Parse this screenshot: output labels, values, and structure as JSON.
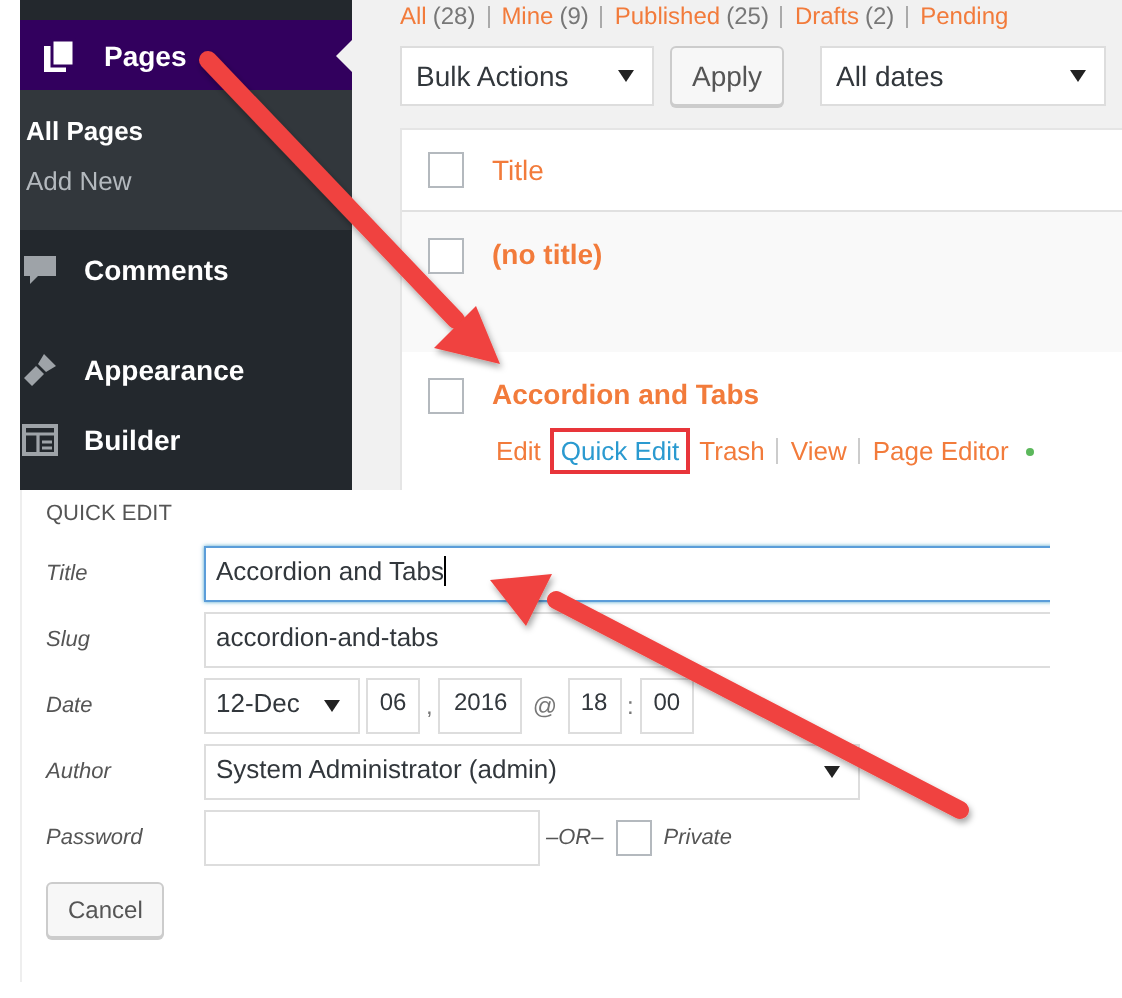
{
  "sidebar": {
    "menu": {
      "label": "Pages",
      "selected": true
    },
    "submenu": [
      {
        "label": "All Pages",
        "selected": true
      },
      {
        "label": "Add New",
        "selected": false
      }
    ],
    "items": [
      {
        "label": "Comments",
        "kind": "comments"
      },
      {
        "label": "Appearance",
        "kind": "appearance"
      },
      {
        "label": "Builder",
        "kind": "builder"
      }
    ]
  },
  "filters": [
    {
      "label": "All",
      "count": "(28)"
    },
    {
      "label": "Mine",
      "count": "(9)"
    },
    {
      "label": "Published",
      "count": "(25)"
    },
    {
      "label": "Drafts",
      "count": "(2)"
    },
    {
      "label": "Pending"
    }
  ],
  "toolbar": {
    "bulk_actions": "Bulk Actions",
    "apply": "Apply",
    "dates": "All dates"
  },
  "table": {
    "column": "Title",
    "header_checked": false,
    "rows": [
      {
        "title": "(no title)",
        "checked": false,
        "actions": []
      },
      {
        "title": "Accordion and Tabs",
        "checked": false,
        "actions": [
          {
            "label": "Edit",
            "highlighted": false
          },
          {
            "label": "Quick Edit",
            "highlighted": true
          },
          {
            "label": "Trash",
            "highlighted": false
          },
          {
            "label": "View",
            "highlighted": false
          },
          {
            "label": "Page Editor",
            "highlighted": false
          }
        ]
      }
    ]
  },
  "quick_edit": {
    "heading": "QUICK EDIT",
    "title_label": "Title",
    "title_value": "Accordion and Tabs",
    "slug_label": "Slug",
    "slug_value": "accordion-and-tabs",
    "date_label": "Date",
    "month": "12-Dec",
    "day": "06",
    "date_sep": ",",
    "year": "2016",
    "at": "@",
    "hour": "18",
    "time_sep": ":",
    "minute": "00",
    "author_label": "Author",
    "author": "System Administrator (admin)",
    "password_label": "Password",
    "or": "–OR–",
    "private_label": "Private",
    "private_checked": false,
    "cancel": "Cancel"
  }
}
